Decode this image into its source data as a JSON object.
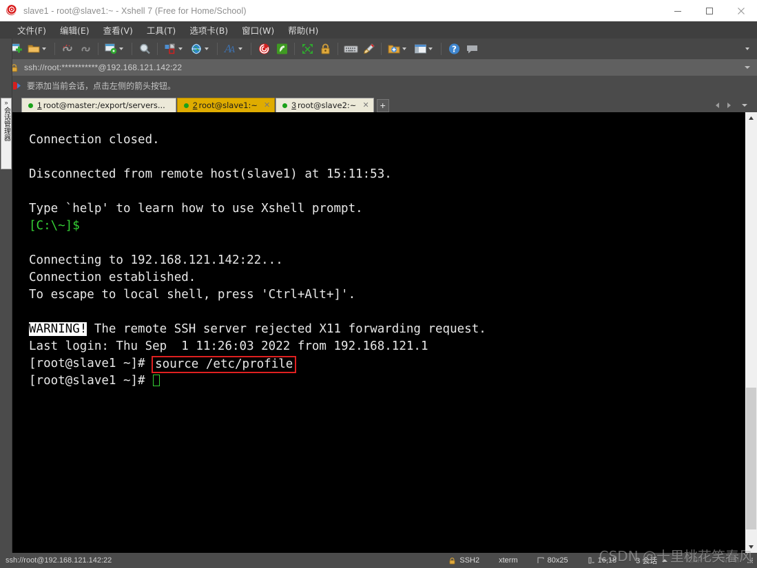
{
  "window": {
    "title": "slave1 - root@slave1:~ - Xshell 7 (Free for Home/School)",
    "logo_icon": "xshell-spiral-icon",
    "minimize_label": "—",
    "maximize_label": "□",
    "close_label": "✕"
  },
  "menubar": {
    "items": [
      {
        "label": "文件(F)",
        "name": "menu-file"
      },
      {
        "label": "编辑(E)",
        "name": "menu-edit"
      },
      {
        "label": "查看(V)",
        "name": "menu-view"
      },
      {
        "label": "工具(T)",
        "name": "menu-tools"
      },
      {
        "label": "选项卡(B)",
        "name": "menu-tabs"
      },
      {
        "label": "窗口(W)",
        "name": "menu-window"
      },
      {
        "label": "帮助(H)",
        "name": "menu-help"
      }
    ]
  },
  "toolbar": {
    "icons": [
      "new-session-icon",
      "open-folder-icon",
      "disconnect-icon",
      "reconnect-icon",
      "session-properties-icon",
      "find-icon",
      "layout-icon",
      "web-globe-icon",
      "font-icon",
      "xshell-icon",
      "xftp-icon",
      "fullscreen-icon",
      "lock-icon",
      "keyboard-icon",
      "highlight-pen-icon",
      "new-folder-icon",
      "split-view-icon",
      "help-icon",
      "comment-icon"
    ]
  },
  "address_bar": {
    "lock_icon": "padlock-icon",
    "url": "ssh://root:***********@192.168.121.142:22",
    "dropdown_icon": "chevron-down-icon"
  },
  "hint_bar": {
    "icon": "red-blue-arrow-icon",
    "text": "要添加当前会话，点击左侧的箭头按钮。"
  },
  "side_panel": {
    "chevron_icon": "chevron-right-icon",
    "label": "会话管理器"
  },
  "tabs": {
    "items": [
      {
        "num": "1",
        "label": "root@master:/export/servers...",
        "active": false,
        "status": "connected",
        "close_icon": "close-icon"
      },
      {
        "num": "2",
        "label": "root@slave1:~",
        "active": true,
        "status": "connected",
        "close_icon": "close-icon"
      },
      {
        "num": "3",
        "label": "root@slave2:~",
        "active": false,
        "status": "connected",
        "close_icon": "close-icon"
      }
    ],
    "add_label": "+",
    "nav_prev_icon": "triangle-left-icon",
    "nav_next_icon": "triangle-right-icon",
    "nav_menu_icon": "chevron-down-icon"
  },
  "terminal": {
    "lines": [
      {
        "text": "Connection closed."
      },
      {
        "text": ""
      },
      {
        "text": "Disconnected from remote host(slave1) at 15:11:53."
      },
      {
        "text": ""
      },
      {
        "text": "Type `help' to learn how to use Xshell prompt."
      },
      {
        "text": "[C:\\~]$",
        "color": "green"
      },
      {
        "text": ""
      },
      {
        "text": "Connecting to 192.168.121.142:22..."
      },
      {
        "text": "Connection established."
      },
      {
        "text": "To escape to local shell, press 'Ctrl+Alt+]'."
      },
      {
        "text": ""
      }
    ],
    "warning_label": "WARNING!",
    "warning_rest": " The remote SSH server rejected X11 forwarding request.",
    "last_login": "Last login: Thu Sep  1 11:26:03 2022 from 192.168.121.1",
    "prompt": "[root@slave1 ~]# ",
    "command": "source /etc/profile",
    "prompt2": "[root@slave1 ~]# ",
    "highlight_color": "#e02020",
    "cursor_color": "#35d135",
    "fg_color": "#e8e8e8",
    "bg_color": "#000000"
  },
  "scrollbar": {
    "up_icon": "chevron-up-icon",
    "down_icon": "chevron-down-icon"
  },
  "status_bar": {
    "connection": "ssh://root@192.168.121.142:22",
    "security": {
      "icon": "padlock-icon",
      "label": "SSH2"
    },
    "terminal_type": "xterm",
    "size": {
      "icon": "resize-icon",
      "label": "80x25"
    },
    "cursor_pos": {
      "icon": "cursor-icon",
      "label": "16,18"
    },
    "sessions": {
      "label": "3 会话",
      "caret_icon": "caret-up-icon"
    },
    "caps": "CAP",
    "num": "NUM",
    "grip_icon": "resize-grip-icon"
  },
  "watermark": {
    "text": "CSDN @十里桃花笑春风"
  }
}
